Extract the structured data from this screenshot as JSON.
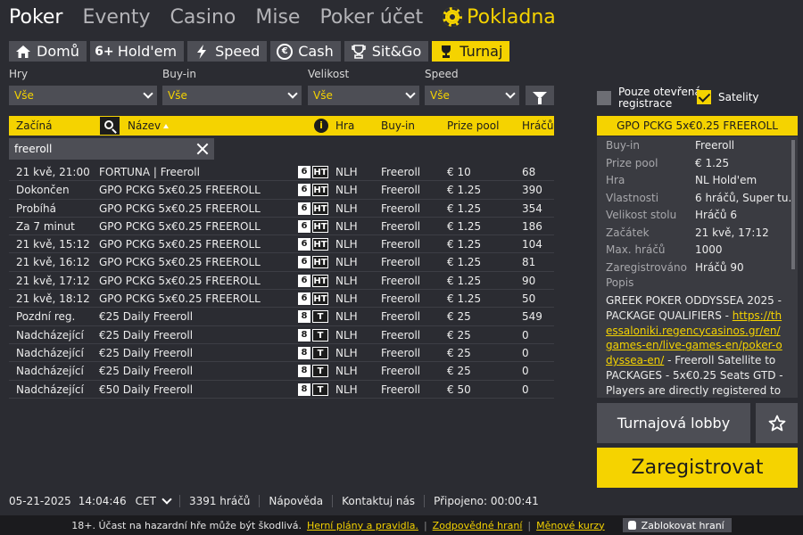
{
  "topnav": {
    "items": [
      "Poker",
      "Eventy",
      "Casino",
      "Mise",
      "Poker účet"
    ],
    "cashier": "Pokladna"
  },
  "tabs": [
    {
      "label": "Domů",
      "icon": "home-icon"
    },
    {
      "label": "Hold'em",
      "icon": "six-plus-icon",
      "icon_text": "6+"
    },
    {
      "label": "Speed",
      "icon": "lightning-icon"
    },
    {
      "label": "Cash",
      "icon": "euro-icon"
    },
    {
      "label": "Sit&Go",
      "icon": "trophy-icon"
    },
    {
      "label": "Turnaj",
      "icon": "trophy-cup-icon",
      "active": true
    }
  ],
  "filters": {
    "hry": {
      "label": "Hry",
      "value": "Vše"
    },
    "buyin": {
      "label": "Buy-in",
      "value": "Vše"
    },
    "velikost": {
      "label": "Velikost",
      "value": "Vše"
    },
    "speed": {
      "label": "Speed",
      "value": "Vše"
    }
  },
  "options": {
    "open_reg": "Pouze otevřená registrace",
    "satellite": "Satelity"
  },
  "table": {
    "headers": {
      "start": "Začíná",
      "name": "Název",
      "game": "Hra",
      "buyin": "Buy-in",
      "prize": "Prize pool",
      "players": "Hráčů"
    },
    "search_value": "freeroll",
    "rows": [
      {
        "start": "21 kvě, 21:00",
        "name": "FORTUNA | Freeroll",
        "size": "6",
        "type": "HT",
        "game": "NLH",
        "buyin": "Freeroll",
        "prize": "€ 10",
        "players": "68"
      },
      {
        "start": "Dokončen",
        "name": "GPO PCKG 5x€0.25 FREEROLL",
        "size": "6",
        "type": "HT",
        "game": "NLH",
        "buyin": "Freeroll",
        "prize": "€ 1.25",
        "players": "390"
      },
      {
        "start": "Probíhá",
        "name": "GPO PCKG 5x€0.25 FREEROLL",
        "size": "6",
        "type": "HT",
        "game": "NLH",
        "buyin": "Freeroll",
        "prize": "€ 1.25",
        "players": "354"
      },
      {
        "start": "Za 7 minut",
        "name": "GPO PCKG 5x€0.25 FREEROLL",
        "size": "6",
        "type": "HT",
        "game": "NLH",
        "buyin": "Freeroll",
        "prize": "€ 1.25",
        "players": "186"
      },
      {
        "start": "21 kvě, 15:12",
        "name": "GPO PCKG 5x€0.25 FREEROLL",
        "size": "6",
        "type": "HT",
        "game": "NLH",
        "buyin": "Freeroll",
        "prize": "€ 1.25",
        "players": "104"
      },
      {
        "start": "21 kvě, 16:12",
        "name": "GPO PCKG 5x€0.25 FREEROLL",
        "size": "6",
        "type": "HT",
        "game": "NLH",
        "buyin": "Freeroll",
        "prize": "€ 1.25",
        "players": "81"
      },
      {
        "start": "21 kvě, 17:12",
        "name": "GPO PCKG 5x€0.25 FREEROLL",
        "size": "6",
        "type": "HT",
        "game": "NLH",
        "buyin": "Freeroll",
        "prize": "€ 1.25",
        "players": "90"
      },
      {
        "start": "21 kvě, 18:12",
        "name": "GPO PCKG 5x€0.25 FREEROLL",
        "size": "6",
        "type": "HT",
        "game": "NLH",
        "buyin": "Freeroll",
        "prize": "€ 1.25",
        "players": "50"
      },
      {
        "start": "Pozdní reg.",
        "name": "€25 Daily Freeroll",
        "size": "8",
        "type": "T",
        "game": "NLH",
        "buyin": "Freeroll",
        "prize": "€ 25",
        "players": "549"
      },
      {
        "start": "Nadcházející",
        "name": "€25 Daily Freeroll",
        "size": "8",
        "type": "T",
        "game": "NLH",
        "buyin": "Freeroll",
        "prize": "€ 25",
        "players": "0"
      },
      {
        "start": "Nadcházející",
        "name": "€25 Daily Freeroll",
        "size": "8",
        "type": "T",
        "game": "NLH",
        "buyin": "Freeroll",
        "prize": "€ 25",
        "players": "0"
      },
      {
        "start": "Nadcházející",
        "name": "€25 Daily Freeroll",
        "size": "8",
        "type": "T",
        "game": "NLH",
        "buyin": "Freeroll",
        "prize": "€ 25",
        "players": "0"
      },
      {
        "start": "Nadcházející",
        "name": "€50 Daily Freeroll",
        "size": "8",
        "type": "T",
        "game": "NLH",
        "buyin": "Freeroll",
        "prize": "€ 50",
        "players": "0"
      }
    ]
  },
  "detail": {
    "title": "GPO PCKG 5x€0.25 FREEROLL",
    "fields": [
      {
        "k": "Buy-in",
        "v": "Freeroll"
      },
      {
        "k": "Prize pool",
        "v": "€ 1.25"
      },
      {
        "k": "Hra",
        "v": "NL Hold'em"
      },
      {
        "k": "Vlastnosti",
        "v": "6 hráčů, Super tu..."
      },
      {
        "k": "Velikost stolu",
        "v": "Hráčů 6"
      },
      {
        "k": "Začátek",
        "v": "21 kvě, 17:12"
      },
      {
        "k": "Max. hráčů",
        "v": "1000"
      },
      {
        "k": "Zaregistrováno",
        "v": "Hráčů 90"
      }
    ],
    "desc_label": "Popis",
    "desc_before": "GREEK POKER ODDYSSEA 2025 - PACKAGE QUALIFIERS - ",
    "desc_link": "https://thessaloniki.regencycasinos.gr/en/games-en/live-games-en/poker-odyssea-en/",
    "desc_after": " - Freeroll Satellite to PACKAGES - 5x€0.25 Seats GTD - Players are directly registered to"
  },
  "buttons": {
    "lobby": "Turnajová lobby",
    "register": "Zaregistrovat"
  },
  "status": {
    "date": "05-21-2025",
    "time": "14:04:46",
    "tz": "CET",
    "players": "3391 hráčů",
    "help": "Nápověda",
    "contact": "Kontaktuj nás",
    "connected": "Připojeno: 00:00:41"
  },
  "footer": {
    "warning": "18+. Účast na hazardní hře může být škodlivá.",
    "link1": "Herní plány a pravidla.",
    "link2": "Zodpovědné hraní",
    "link3": "Měnové kurzy",
    "block": "Zablokovat hraní"
  },
  "colors": {
    "accent": "#f5d300",
    "bg": "#2b2c32",
    "panel": "#4d4e55"
  }
}
